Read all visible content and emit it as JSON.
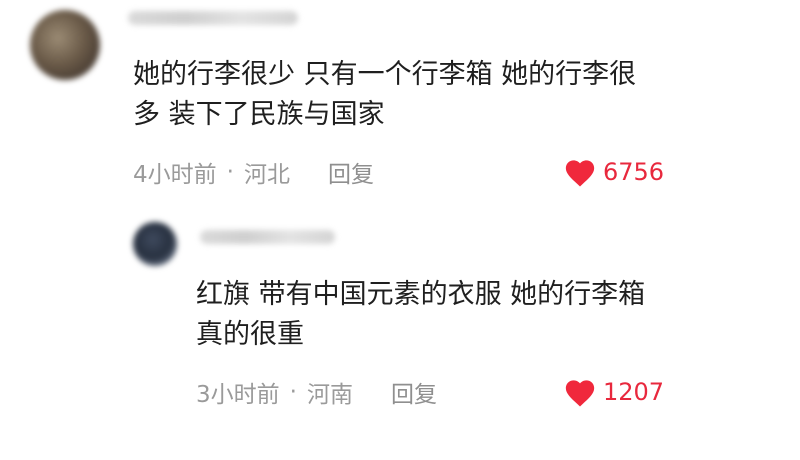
{
  "comment": {
    "avatar_icon": "user-avatar-blurred",
    "text": "她的行李很少 只有一个行李箱 她的行李很\n多 装下了民族与国家",
    "time": "4小时前",
    "separator": "·",
    "location": "河北",
    "reply_label": "回复",
    "like_icon": "heart-icon",
    "like_count": "6756"
  },
  "reply": {
    "avatar_icon": "user-avatar-blurred",
    "text": "红旗 带有中国元素的衣服 她的行李箱\n真的很重",
    "time": "3小时前",
    "separator": "·",
    "location": "河南",
    "reply_label": "回复",
    "like_icon": "heart-icon",
    "like_count": "1207"
  },
  "colors": {
    "heart": "#f0283c",
    "meta": "#9a9a9a",
    "text": "#1f1f1f"
  }
}
